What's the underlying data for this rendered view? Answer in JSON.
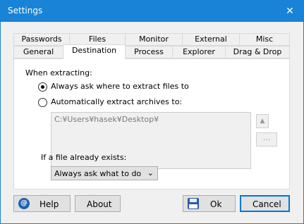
{
  "window": {
    "title": "Settings",
    "close_glyph": "✕"
  },
  "tabs_row1": [
    "Passwords",
    "Files",
    "Monitor",
    "External",
    "Misc"
  ],
  "tabs_row2": [
    "General",
    "Destination",
    "Process",
    "Explorer",
    "Drag & Drop"
  ],
  "active_tab": "Destination",
  "panel": {
    "when_extracting_label": "When extracting:",
    "option_ask": "Always ask where to extract files to",
    "option_auto": "Automatically extract archives to:",
    "selected_option": "option_ask",
    "path_value": "C:¥Users¥hasek¥Desktop¥",
    "up_button_glyph": "▲",
    "browse_button_label": "...",
    "if_exists_label": "If a file already exists:",
    "if_exists_value": "Always ask what to do",
    "chevron_glyph": "⌄"
  },
  "buttons": {
    "help_label": "Help",
    "help_icon_glyph": "@",
    "about_label": "About",
    "ok_label": "Ok",
    "cancel_label": "Cancel"
  },
  "colors": {
    "titlebar": "#1883d7",
    "default_button_border": "#0078d7"
  },
  "icons": {
    "help": "at-sign-icon",
    "ok": "save-disk-icon",
    "close": "close-icon",
    "up": "up-arrow-icon",
    "dropdown": "chevron-down-icon"
  }
}
